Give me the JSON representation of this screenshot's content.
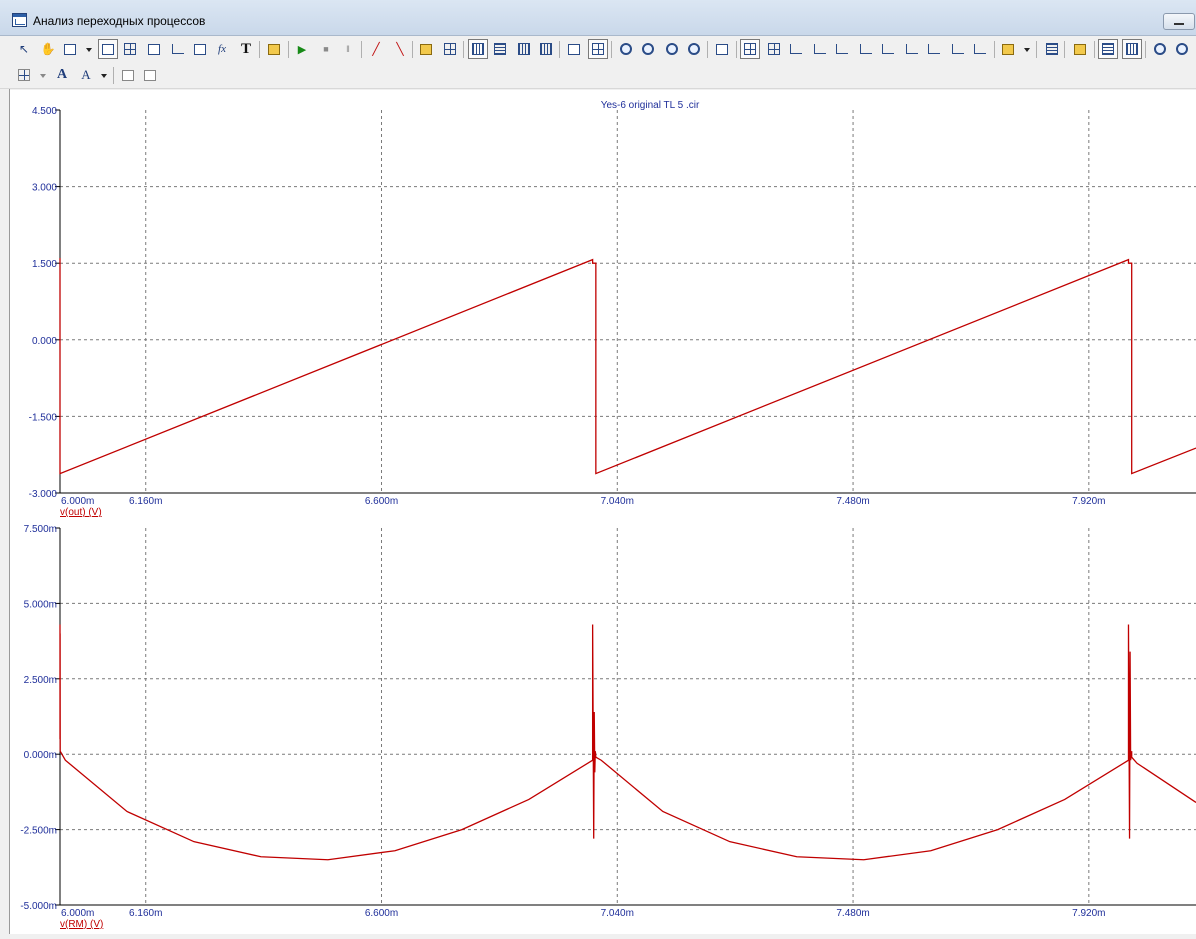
{
  "window": {
    "title": "Анализ переходных процессов"
  },
  "toolbar_icons": [
    "pointer-icon",
    "hand-icon",
    "select-mode-icon",
    "select-mode-dropdown-icon",
    "diagram-icon",
    "diagram-grid-icon",
    "diagram-axes-icon",
    "diagram-xy-icon",
    "diagram-curve-icon",
    "formula-icon",
    "text-icon",
    "properties-icon",
    "run-icon",
    "stop-icon",
    "pause-icon",
    "cursor-marker-icon",
    "cursor-delete-icon",
    "frame-icon",
    "frame-grid-icon",
    "vertical-layout-icon",
    "horizontal-layout-icon",
    "column-layout-icon",
    "row-layout-icon",
    "split-horizontal-icon",
    "split-grid-icon",
    "zoom-x-icon",
    "zoom-y-icon",
    "zoom-fit-icon",
    "zoom-reset-icon",
    "graph-settings-icon",
    "cursor-left-icon",
    "cursor-right-icon",
    "peak-icon",
    "valley-icon",
    "rise-icon",
    "fall-icon",
    "slope-up-icon",
    "slope-down-icon",
    "cross-icon",
    "multi-cross-icon",
    "multi-peak-icon",
    "clipboard-icon",
    "clipboard-dropdown-icon",
    "table-icon",
    "data-icon",
    "fit-horizontal-icon",
    "fit-vertical-icon",
    "zoom-in-icon",
    "zoom-out-icon"
  ],
  "toolbar2_icons": [
    "grid-layout-icon",
    "grid-dropdown-icon",
    "font-icon",
    "font-style-icon",
    "font-dropdown-icon",
    "copy-icon",
    "paste-icon"
  ],
  "chart_data": [
    {
      "type": "line",
      "title": "Yes-6 original TL 5 .cir",
      "ylabel": "v(out) (V)",
      "xlim": [
        0.006,
        0.00812
      ],
      "ylim": [
        -3.0,
        4.5
      ],
      "yticks": [
        "4.500",
        "3.000",
        "1.500",
        "0.000",
        "-1.500",
        "-3.000"
      ],
      "xticks": [
        "6.000m",
        "6.160m",
        "6.600m",
        "7.040m",
        "7.480m",
        "7.920m"
      ],
      "series": [
        {
          "color": "#c00000",
          "x": [
            0.006,
            0.006,
            0.00600002,
            0.006994,
            0.006994,
            0.007,
            0.007,
            0.007994,
            0.007994,
            0.008,
            0.008,
            0.00812
          ],
          "y": [
            1.6,
            -2.62,
            -2.62,
            1.57,
            1.5,
            1.5,
            -2.62,
            1.57,
            1.5,
            1.5,
            -2.62,
            -2.12
          ]
        }
      ]
    },
    {
      "type": "line",
      "ylabel": "v(RM) (V)",
      "xlim": [
        0.006,
        0.00812
      ],
      "ylim": [
        -0.005,
        0.0075
      ],
      "yticks": [
        "7.500m",
        "5.000m",
        "2.500m",
        "0.000m",
        "-2.500m",
        "-5.000m"
      ],
      "xticks": [
        "6.000m",
        "6.160m",
        "6.600m",
        "7.040m",
        "7.480m",
        "7.920m"
      ],
      "series": [
        {
          "color": "#c00000",
          "x": [
            0.006,
            0.006,
            0.0060002,
            0.0060004,
            0.00601,
            0.006125,
            0.00625,
            0.006375,
            0.0065,
            0.006625,
            0.00675,
            0.006875,
            0.006994,
            0.006994,
            0.006996,
            0.006997,
            0.006998,
            0.006999,
            0.007,
            0.00701,
            0.007125,
            0.00725,
            0.007375,
            0.0075,
            0.007625,
            0.00775,
            0.007875,
            0.007994,
            0.007994,
            0.007996,
            0.007997,
            0.007998,
            0.008,
            0.008,
            0.00801,
            0.00812
          ],
          "y": [
            0.0043,
            0.0005,
            0.004,
            0.0001,
            -0.0002,
            -0.0019,
            -0.0029,
            -0.0034,
            -0.0035,
            -0.0032,
            -0.0025,
            -0.0015,
            -0.0002,
            0.0043,
            -0.0028,
            0.0014,
            -0.0006,
            0.0001,
            -0.0001,
            -0.0002,
            -0.0019,
            -0.0029,
            -0.0034,
            -0.0035,
            -0.0032,
            -0.0025,
            -0.0015,
            -0.0002,
            0.0043,
            -0.0028,
            0.0034,
            -0.0002,
            0.0001,
            -0.0001,
            -0.0003,
            -0.0016
          ]
        }
      ]
    }
  ]
}
